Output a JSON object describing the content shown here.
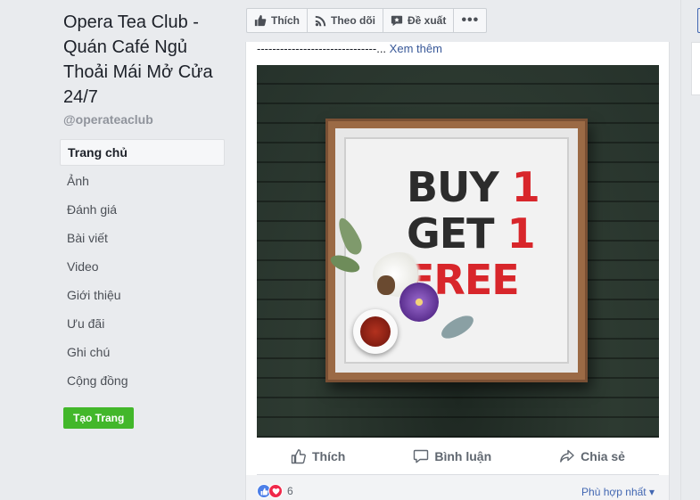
{
  "left": {
    "page_name": "Opera Tea Club - Quán Café Ngủ Thoải Mái Mở Cửa 24/7",
    "handle": "@operateaclub",
    "nav": [
      {
        "label": "Trang chủ",
        "active": true
      },
      {
        "label": "Ảnh"
      },
      {
        "label": "Đánh giá"
      },
      {
        "label": "Bài viết"
      },
      {
        "label": "Video"
      },
      {
        "label": "Giới thiệu"
      },
      {
        "label": "Ưu đãi"
      },
      {
        "label": "Ghi chú"
      },
      {
        "label": "Cộng đồng"
      }
    ],
    "create_page": "Tạo Trang"
  },
  "actionbar": {
    "like": "Thích",
    "follow": "Theo dõi",
    "suggest": "Đề xuất",
    "more": "•••"
  },
  "post": {
    "dashes": "-------------------------------...",
    "see_more": "Xem thêm",
    "image": {
      "line1a": "BUY",
      "line1b": "1",
      "line2a": "GET",
      "line2b": "1",
      "line3": "FREE"
    },
    "actions": {
      "like": "Thích",
      "comment": "Bình luận",
      "share": "Chia sẻ"
    },
    "reactions_count": "6",
    "sort": "Phù hợp nhất ▾"
  },
  "colors": {
    "brand_blue": "#4267b2",
    "green_button": "#42b72a",
    "promo_red": "#d8262b"
  }
}
